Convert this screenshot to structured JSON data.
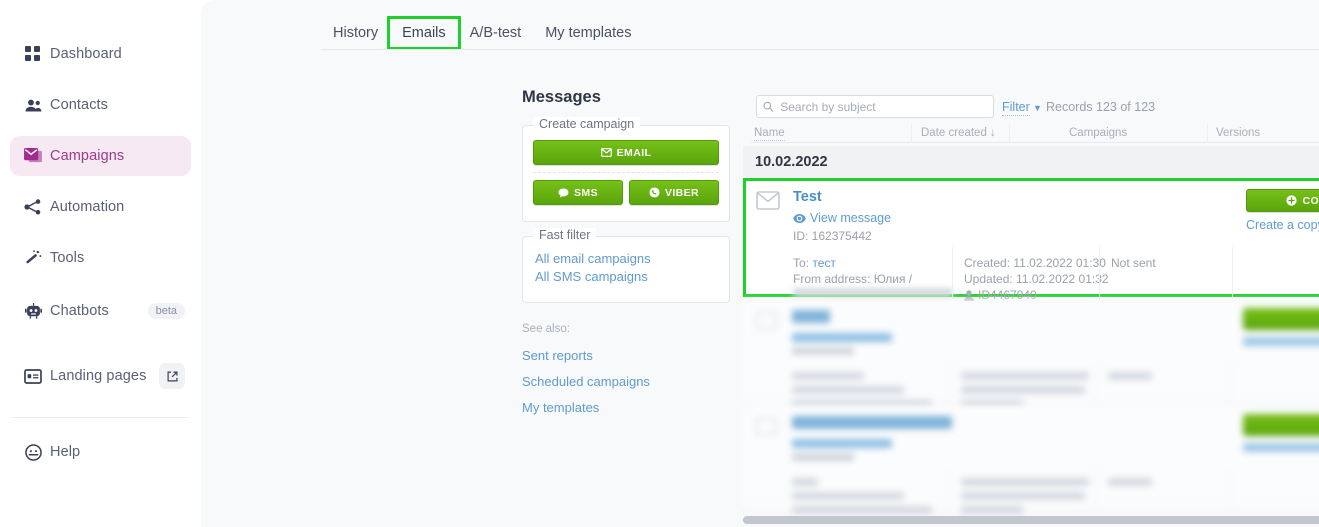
{
  "sidebar": {
    "items": [
      {
        "label": "Dashboard",
        "icon": "grid-icon",
        "badge": null,
        "active": false
      },
      {
        "label": "Contacts",
        "icon": "people-icon",
        "badge": null,
        "active": false
      },
      {
        "label": "Campaigns",
        "icon": "envelope-stack-icon",
        "badge": null,
        "active": true
      },
      {
        "label": "Automation",
        "icon": "share-nodes-icon",
        "badge": null,
        "active": false
      },
      {
        "label": "Tools",
        "icon": "magic-wand-icon",
        "badge": null,
        "active": false
      },
      {
        "label": "Chatbots",
        "icon": "robot-icon",
        "badge": "beta",
        "active": false
      },
      {
        "label": "Landing pages",
        "icon": "landing-page-icon",
        "badge": "external-link",
        "active": false
      },
      {
        "label": "Help",
        "icon": "help-icon",
        "badge": null,
        "active": false
      }
    ],
    "active_bg": "#f7e9f2",
    "active_fg": "#9c3a8e"
  },
  "tabs": {
    "items": [
      {
        "label": "History",
        "highlighted": false
      },
      {
        "label": "Emails",
        "highlighted": true
      },
      {
        "label": "A/B-test",
        "highlighted": false
      },
      {
        "label": "My templates",
        "highlighted": false
      }
    ],
    "highlight_color": "#20d02a"
  },
  "left_panel": {
    "title": "Messages",
    "create_campaign": {
      "legend": "Create campaign",
      "email_label": "EMAIL",
      "sms_label": "SMS",
      "viber_label": "VIBER"
    },
    "fast_filter": {
      "legend": "Fast filter",
      "links": [
        "All email campaigns",
        "All SMS campaigns"
      ]
    },
    "see_also": {
      "label": "See also:",
      "links": [
        "Sent reports",
        "Scheduled campaigns",
        "My templates"
      ]
    }
  },
  "toolbar": {
    "search_placeholder": "Search by subject",
    "search_value": "",
    "search_icon": "search-icon",
    "filter_label": "Filter",
    "filter_caret": "▼",
    "records_label": "Records 123 of 123"
  },
  "table": {
    "columns": [
      "Name",
      "Date created ↓",
      "Campaigns",
      "Versions"
    ],
    "date_group": "10.02.2022",
    "row": {
      "icon": "envelope-outline-icon",
      "title": "Test",
      "view_message": "View message",
      "view_icon": "eye-icon",
      "id": "ID: 162375442",
      "to_label": "To:",
      "to_value": "тест",
      "from": "From address: Юлия /",
      "created": "Created: 11.02.2022 01:30",
      "updated": "Updated: 11.02.2022 01:32",
      "user_icon": "user-icon",
      "user_id": "ID4467940",
      "status": "Not sent",
      "continue_label": "CONTINUE",
      "continue_icon": "plus-circle-icon",
      "create_copy": "Create a copy",
      "highlighted": true
    }
  },
  "colors": {
    "green_button": "#65b215",
    "highlight_green": "#20d02a",
    "link_blue": "#5f9bd2",
    "muted": "#9aa0ac"
  }
}
